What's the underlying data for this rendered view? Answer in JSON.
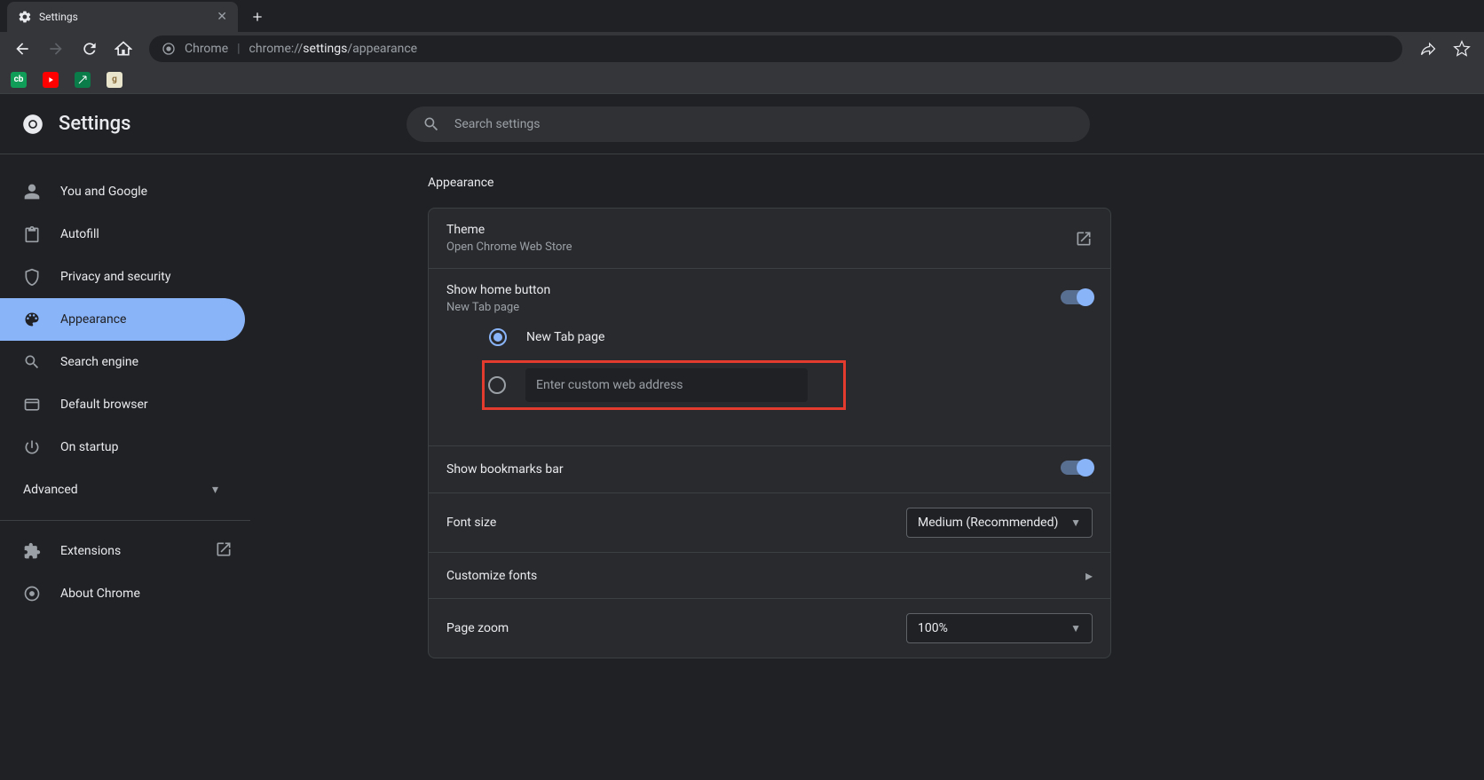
{
  "tab": {
    "title": "Settings"
  },
  "omnibox": {
    "prefix": "Chrome",
    "path_dim1": "chrome://",
    "path_bright": "settings",
    "path_dim2": "/appearance"
  },
  "header": {
    "title": "Settings",
    "search_placeholder": "Search settings"
  },
  "sidebar": {
    "items": [
      {
        "label": "You and Google"
      },
      {
        "label": "Autofill"
      },
      {
        "label": "Privacy and security"
      },
      {
        "label": "Appearance"
      },
      {
        "label": "Search engine"
      },
      {
        "label": "Default browser"
      },
      {
        "label": "On startup"
      }
    ],
    "advanced": "Advanced",
    "extensions": "Extensions",
    "about": "About Chrome"
  },
  "main": {
    "section_title": "Appearance",
    "theme": {
      "title": "Theme",
      "sub": "Open Chrome Web Store"
    },
    "home_button": {
      "title": "Show home button",
      "sub": "New Tab page",
      "radio1": "New Tab page",
      "custom_placeholder": "Enter custom web address"
    },
    "bookmarks_bar": "Show bookmarks bar",
    "font_size": {
      "label": "Font size",
      "value": "Medium (Recommended)"
    },
    "customize_fonts": "Customize fonts",
    "page_zoom": {
      "label": "Page zoom",
      "value": "100%"
    }
  }
}
